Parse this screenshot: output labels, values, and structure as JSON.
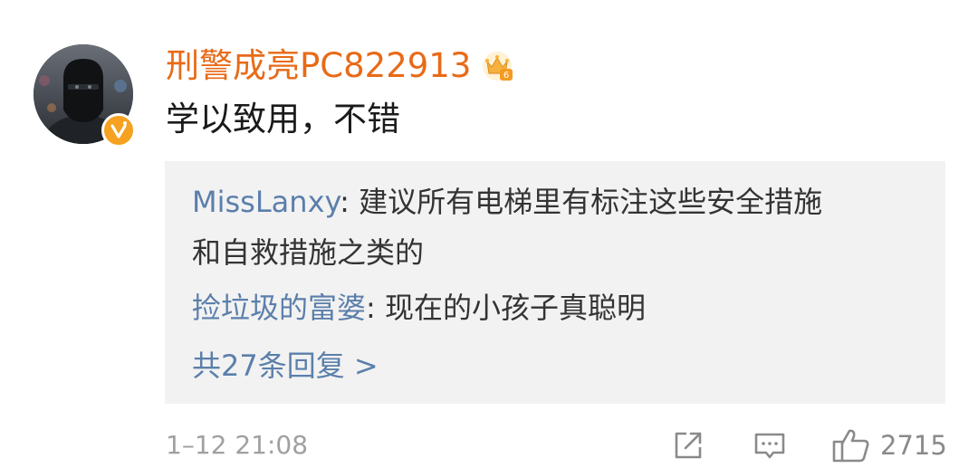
{
  "comment": {
    "username": "刑警成亮PC822913",
    "text": "学以致用，不错",
    "timestamp": "1–12 21:08",
    "vip_level": "6",
    "verified": true,
    "colors": {
      "username": "#e86a17",
      "link": "#5b7fab",
      "badge": "#f6a11f",
      "reply_bg": "#f2f2f2"
    }
  },
  "replies": [
    {
      "user": "MissLanxy",
      "separator": ": ",
      "text_line1": "建议所有电梯里有标注这些安全措施",
      "text_line2": "和自救措施之类的"
    },
    {
      "user": "捡垃圾的富婆",
      "separator": ": ",
      "text_line1": "现在的小孩子真聪明"
    }
  ],
  "more_replies": "共27条回复 >",
  "actions": {
    "share_icon": "share-icon",
    "comment_icon": "comment-icon",
    "like_icon": "thumbs-up-icon",
    "like_count": "2715"
  }
}
